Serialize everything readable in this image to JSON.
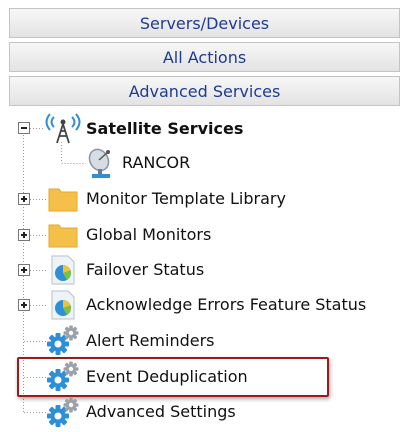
{
  "nav": {
    "buttons": [
      {
        "label": "Servers/Devices"
      },
      {
        "label": "All Actions"
      },
      {
        "label": "Advanced Services"
      }
    ]
  },
  "tree": {
    "satellite_services": {
      "label": "Satellite Services",
      "expanded": true,
      "icon": "satellite-antenna-icon"
    },
    "rancor": {
      "label": "RANCOR",
      "icon": "satellite-dish-icon"
    },
    "monitor_template_library": {
      "label": "Monitor Template Library",
      "icon": "folder-icon"
    },
    "global_monitors": {
      "label": "Global Monitors",
      "icon": "folder-icon"
    },
    "failover_status": {
      "label": "Failover Status",
      "icon": "pie-report-icon"
    },
    "acknowledge_errors": {
      "label": "Acknowledge Errors Feature Status",
      "icon": "pie-report-icon"
    },
    "alert_reminders": {
      "label": "Alert Reminders",
      "icon": "gears-icon"
    },
    "event_deduplication": {
      "label": "Event Deduplication",
      "icon": "gears-icon",
      "highlighted": true
    },
    "advanced_settings": {
      "label": "Advanced Settings",
      "icon": "gears-icon"
    }
  },
  "colors": {
    "nav_text": "#1f3a93",
    "highlight_border": "#9b1b1b",
    "folder": "#f5c04a"
  }
}
